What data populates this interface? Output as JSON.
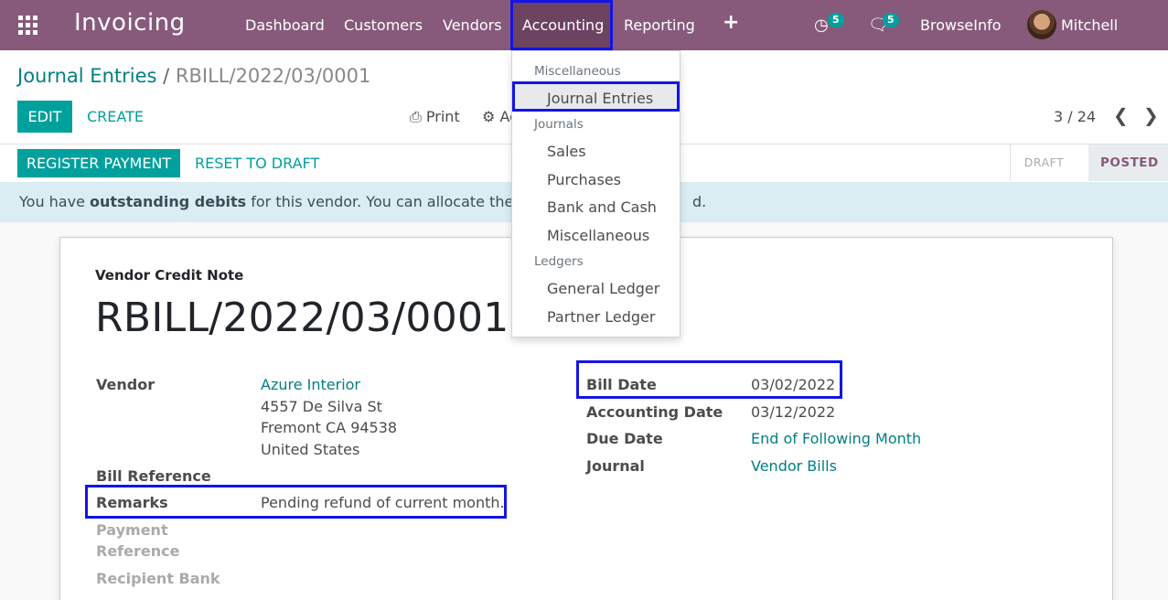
{
  "navbar": {
    "app_name": "Invoicing",
    "menu": [
      "Dashboard",
      "Customers",
      "Vendors",
      "Accounting",
      "Reporting"
    ],
    "activity_count": "5",
    "message_count": "5",
    "company": "BrowseInfo",
    "user": "Mitchell Admin"
  },
  "breadcrumb": {
    "parent": "Journal Entries",
    "separator": "/",
    "current": "RBILL/2022/03/0001"
  },
  "controls": {
    "edit": "EDIT",
    "create": "CREATE",
    "print": "Print",
    "action": "Ac",
    "pager": "3 / 24"
  },
  "statusbar": {
    "register_payment": "REGISTER PAYMENT",
    "reset_to_draft": "RESET TO DRAFT",
    "draft": "DRAFT",
    "posted": "POSTED"
  },
  "alert": {
    "prefix": "You have ",
    "bold": "outstanding debits",
    "middle": " for this vendor. You can allocate them",
    "suffix": "d."
  },
  "document": {
    "type": "Vendor Credit Note",
    "name": "RBILL/2022/03/0001",
    "vendor_label": "Vendor",
    "vendor_name": "Azure Interior",
    "vendor_street": "4557 De Silva St",
    "vendor_city": "Fremont CA 94538",
    "vendor_country": "United States",
    "bill_reference_label": "Bill Reference",
    "remarks_label": "Remarks",
    "remarks_value": "Pending refund of current month.",
    "payment_reference_label_1": "Payment",
    "payment_reference_label_2": "Reference",
    "recipient_bank_label": "Recipient Bank",
    "bill_date_label": "Bill Date",
    "bill_date_value": "03/02/2022",
    "accounting_date_label": "Accounting Date",
    "accounting_date_value": "03/12/2022",
    "due_date_label": "Due Date",
    "due_date_value": "End of Following Month",
    "journal_label": "Journal",
    "journal_value": "Vendor Bills"
  },
  "dropdown": {
    "header_misc": "Miscellaneous",
    "journal_entries": "Journal Entries",
    "header_journals": "Journals",
    "sales": "Sales",
    "purchases": "Purchases",
    "bank_cash": "Bank and Cash",
    "miscellaneous": "Miscellaneous",
    "header_ledgers": "Ledgers",
    "general_ledger": "General Ledger",
    "partner_ledger": "Partner Ledger"
  },
  "colors": {
    "navbar": "#875a7b",
    "primary": "#00a09d",
    "link": "#017e84",
    "highlight": "#1414e6"
  }
}
